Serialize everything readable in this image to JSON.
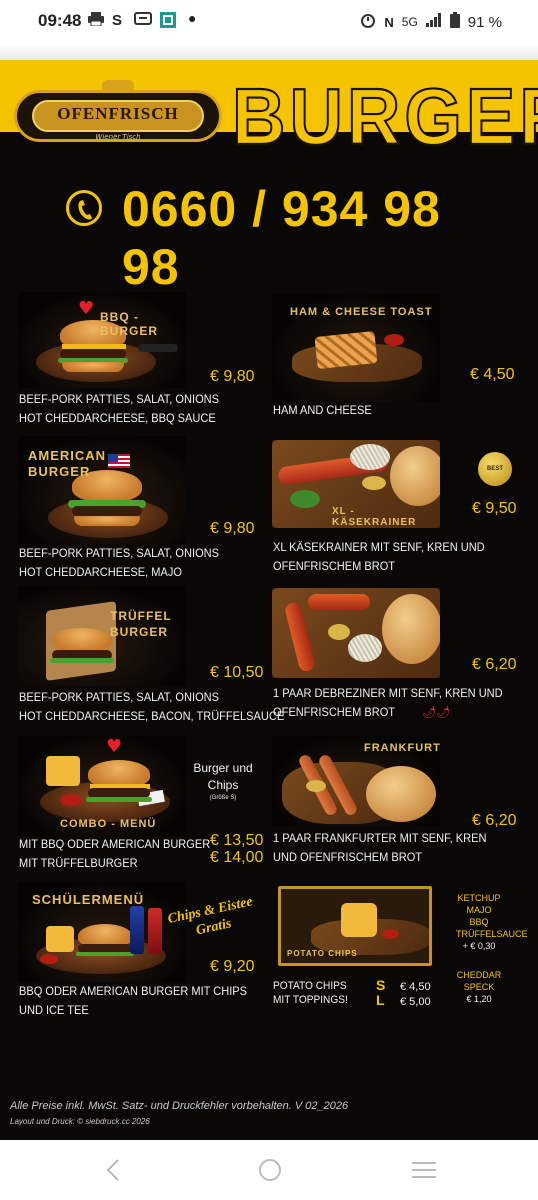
{
  "status_bar": {
    "time": "09:48",
    "icons_left": [
      "print-icon",
      "s-icon",
      "message-icon",
      "qr-icon",
      "dot-icon"
    ],
    "icons_right": [
      "alarm-icon",
      "nfc-icon",
      "5g-icon",
      "signal-icon",
      "battery-icon"
    ],
    "network": "5G",
    "battery": "91 %"
  },
  "header": {
    "logo_name": "OFENFRISCH",
    "logo_sub": "Wiener Tisch",
    "title": "BURGER",
    "phone": "0660 / 934 98 98",
    "accent_color": "#f5c400"
  },
  "left_items": [
    {
      "photo_label": "BBQ - BURGER",
      "desc_line1": "BEEF-PORK PATTIES, SALAT, ONIONS",
      "desc_line2": "HOT CHEDDARCHEESE, BBQ SAUCE",
      "price": "€ 9,80"
    },
    {
      "photo_label_line1": "AMERICAN",
      "photo_label_line2": "BURGER",
      "desc_line1": "BEEF-PORK PATTIES, SALAT, ONIONS",
      "desc_line2": "HOT CHEDDARCHEESE, MAJO",
      "price": "€ 9,80"
    },
    {
      "photo_label_line1": "TRÜFFEL",
      "photo_label_line2": "BURGER",
      "desc_line1": "BEEF-PORK PATTIES, SALAT, ONIONS",
      "desc_line2": "HOT CHEDDARCHEESE, BACON, TRÜFFELSAUCE",
      "price": "€ 10,50"
    },
    {
      "photo_label": "COMBO - MENÜ",
      "side_note_line1": "Burger und",
      "side_note_line2": "Chips",
      "side_note_small": "(Größe S)",
      "desc_line1": "MIT BBQ ODER AMERICAN BURGER",
      "desc_line2": "MIT TRÜFFELBURGER",
      "price1": "€ 13,50",
      "price2": "€ 14,00"
    },
    {
      "photo_label": "SCHÜLERMENÜ",
      "script_line1": "Chips & Eistee",
      "script_line2": "Gratis",
      "desc_line1": "BBQ ODER AMERICAN BURGER MIT  CHIPS",
      "desc_line2": "UND ICE TEE",
      "price": "€ 9,20"
    }
  ],
  "right_items": [
    {
      "photo_label": "HAM & CHEESE TOAST",
      "desc_line1": "HAM AND CHEESE",
      "price": "€ 4,50"
    },
    {
      "photo_label": "XL - KÄSEKRAINER",
      "badge_text": "BEST SELLER",
      "desc_line1": "XL KÄSEKRAINER MIT SENF, KREN UND",
      "desc_line2": "OFENFRISCHEM BROT",
      "price": "€ 9,50"
    },
    {
      "desc_line1": "1 PAAR DEBREZINER MIT SENF, KREN UND",
      "desc_line2": "OFENFRISCHEM BROT",
      "chili": "🌶🌶",
      "price": "€ 6,20"
    },
    {
      "photo_label": "FRANKFURTER",
      "desc_line1": "1 PAAR FRANKFURTER MIT SENF, KREN",
      "desc_line2": "UND OFENFRISCHEM BROT",
      "price": "€ 6,20"
    },
    {
      "photo_label": "POTATO CHIPS",
      "desc_line1": "POTATO CHIPS",
      "desc_line2": "MIT TOPPINGS!",
      "size_s": "S",
      "size_l": "L",
      "price_s": "€ 4,50",
      "price_l": "€ 5,00",
      "toppings": [
        "KETCHUP",
        "MAJO",
        "BBQ",
        "TRÜFFELSAUCE",
        "+ € 0,30"
      ],
      "extra_line1": "CHEDDAR",
      "extra_line2": "SPECK",
      "extra_price": "€ 1,20"
    }
  ],
  "footer": {
    "line1": "Alle Preise inkl. MwSt. Satz- und Druckfehler vorbehalten. V 02_2026",
    "line2": "Layout und Druck: © siebdruck.cc 2026"
  },
  "nav": {
    "back": "back-icon",
    "home": "home-icon",
    "recents": "recents-icon"
  }
}
